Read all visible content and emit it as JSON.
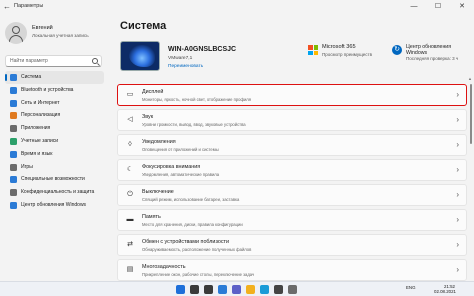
{
  "window": {
    "title": "Параметры",
    "back_glyph": "←",
    "min_glyph": "—",
    "max_glyph": "☐",
    "close_glyph": "✕"
  },
  "profile": {
    "name": "Евгений",
    "account": "Локальная учетная запись"
  },
  "search": {
    "placeholder": "Найти параметр"
  },
  "nav": {
    "items": [
      {
        "label": "Система",
        "icon": "system-icon",
        "color": "#2b7bd6",
        "active": true
      },
      {
        "label": "Bluetooth и устройства",
        "icon": "bluetooth-icon",
        "color": "#2b7bd6"
      },
      {
        "label": "Сеть и Интернет",
        "icon": "network-icon",
        "color": "#2b7bd6"
      },
      {
        "label": "Персонализация",
        "icon": "brush-icon",
        "color": "#e07a1f"
      },
      {
        "label": "Приложения",
        "icon": "apps-icon",
        "color": "#6b6b6b"
      },
      {
        "label": "Учетные записи",
        "icon": "account-icon",
        "color": "#2ca06a"
      },
      {
        "label": "Время и язык",
        "icon": "clock-globe-icon",
        "color": "#2b7bd6"
      },
      {
        "label": "Игры",
        "icon": "gamepad-icon",
        "color": "#6b6b6b"
      },
      {
        "label": "Специальные возможности",
        "icon": "accessibility-icon",
        "color": "#2b7bd6"
      },
      {
        "label": "Конфиденциальность и защита",
        "icon": "shield-icon",
        "color": "#6b6b6b"
      },
      {
        "label": "Центр обновления Windows",
        "icon": "update-icon",
        "color": "#2b7bd6"
      }
    ]
  },
  "main": {
    "title": "Система",
    "device": {
      "name": "WIN-A0GNSLBCSJC",
      "model": "VMware7,1",
      "rename": "Переименовать"
    },
    "m365": {
      "title": "Microsoft 365",
      "subtitle": "Просмотр преимуществ"
    },
    "update": {
      "title": "Центр обновления Windows",
      "subtitle": "Последняя проверка: 3 ч"
    },
    "cards": [
      {
        "title": "Дисплей",
        "subtitle": "Мониторы, яркость, ночной свет, отображение профиля",
        "icon": "display-icon",
        "glyph": "▭",
        "highlight": true
      },
      {
        "title": "Звук",
        "subtitle": "Уровни громкости, вывод, ввод, звуковые устройства",
        "icon": "speaker-icon",
        "glyph": "◁"
      },
      {
        "title": "Уведомления",
        "subtitle": "Оповещения от приложений и системы",
        "icon": "bell-icon",
        "glyph": "◊"
      },
      {
        "title": "Фокусировка внимания",
        "subtitle": "Уведомления, автоматические правила",
        "icon": "moon-icon",
        "glyph": "☾"
      },
      {
        "title": "Выключение",
        "subtitle": "Спящий режим, использование батареи, заставка",
        "icon": "power-icon",
        "glyph": "⏻"
      },
      {
        "title": "Память",
        "subtitle": "Место для хранения, диски, правила конфигурации",
        "icon": "storage-icon",
        "glyph": "▬"
      },
      {
        "title": "Обмен с устройствами поблизости",
        "subtitle": "Обнаруживаемость, расположение полученных файлов",
        "icon": "share-icon",
        "glyph": "⇄"
      },
      {
        "title": "Многозадачность",
        "subtitle": "Прикрепление окон, рабочие столы, переключение задач",
        "icon": "multitask-icon",
        "glyph": "▤"
      }
    ],
    "chevron": "›"
  },
  "taskbar": {
    "icons": [
      {
        "name": "start-icon",
        "color": "#1e6fd9"
      },
      {
        "name": "search-icon",
        "color": "#3a3a3a"
      },
      {
        "name": "task-view-icon",
        "color": "#3a3a3a"
      },
      {
        "name": "widgets-icon",
        "color": "#2b7bd6"
      },
      {
        "name": "chat-icon",
        "color": "#5b5fc7"
      },
      {
        "name": "explorer-icon",
        "color": "#f2b01e"
      },
      {
        "name": "edge-icon",
        "color": "#1a9bd7"
      },
      {
        "name": "store-icon",
        "color": "#444"
      },
      {
        "name": "settings-icon",
        "color": "#6b6b6b"
      }
    ],
    "lang": "ENG",
    "time": "21:52",
    "date": "02.08.2021"
  }
}
